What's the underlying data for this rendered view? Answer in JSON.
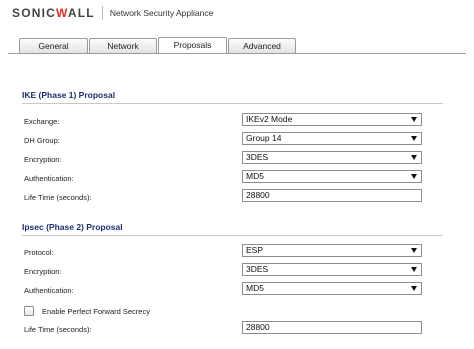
{
  "header": {
    "logo_prefix": "SONIC",
    "logo_highlight": "W",
    "logo_suffix": "ALL",
    "product": "Network Security Appliance"
  },
  "tabs": [
    {
      "label": "General",
      "active": false
    },
    {
      "label": "Network",
      "active": false
    },
    {
      "label": "Proposals",
      "active": true
    },
    {
      "label": "Advanced",
      "active": false
    }
  ],
  "phase1": {
    "title": "IKE (Phase 1) Proposal",
    "exchange": {
      "label": "Exchange:",
      "value": "IKEv2 Mode"
    },
    "dh_group": {
      "label": "DH Group:",
      "value": "Group 14"
    },
    "encryption": {
      "label": "Encryption:",
      "value": "3DES"
    },
    "authentication": {
      "label": "Authentication:",
      "value": "MD5"
    },
    "lifetime": {
      "label": "Life Time (seconds):",
      "value": "28800"
    }
  },
  "phase2": {
    "title": "Ipsec (Phase 2) Proposal",
    "protocol": {
      "label": "Protocol:",
      "value": "ESP"
    },
    "encryption": {
      "label": "Encryption:",
      "value": "3DES"
    },
    "authentication": {
      "label": "Authentication:",
      "value": "MD5"
    },
    "pfs": {
      "label": "Enable Perfect Forward Secrecy",
      "checked": false
    },
    "lifetime": {
      "label": "Life Time (seconds):",
      "value": "28800"
    }
  }
}
